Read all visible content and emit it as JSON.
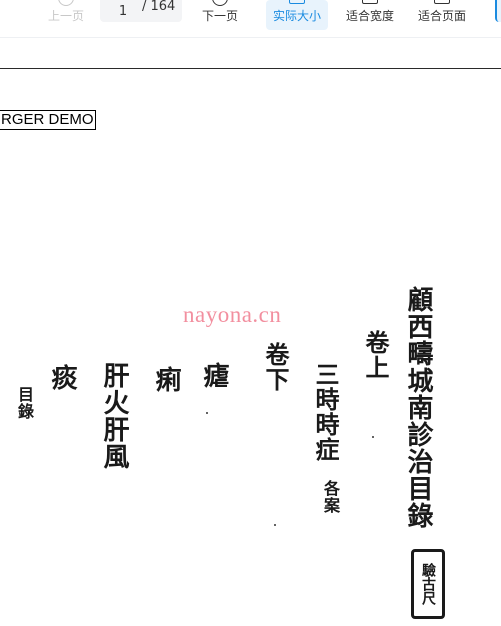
{
  "toolbar": {
    "prev_label": "上一页",
    "page_current": "1",
    "page_total": "/ 164",
    "next_label": "下一页",
    "actual_size_label": "实际大小",
    "fit_width_label": "适合宽度",
    "fit_page_label": "适合页面",
    "active_tool": "实际大小"
  },
  "document": {
    "demo_stamp": "RGER DEMO",
    "watermark": "nayona.cn",
    "columns": {
      "title": "顧西疇城南診治目錄",
      "vol_up": "卷上",
      "three_epidemic": "三時時症",
      "annotation_each": "各案",
      "vol_down": "卷下",
      "malaria": "瘧",
      "dysentery": "痢",
      "liver": "肝火肝風",
      "phlegm": "痰",
      "mulu": "目錄"
    },
    "seal_text": "驗古尺"
  },
  "colors": {
    "accent": "#1a8be0",
    "active_bg": "#e8f3fc",
    "watermark": "#f07c8f"
  }
}
